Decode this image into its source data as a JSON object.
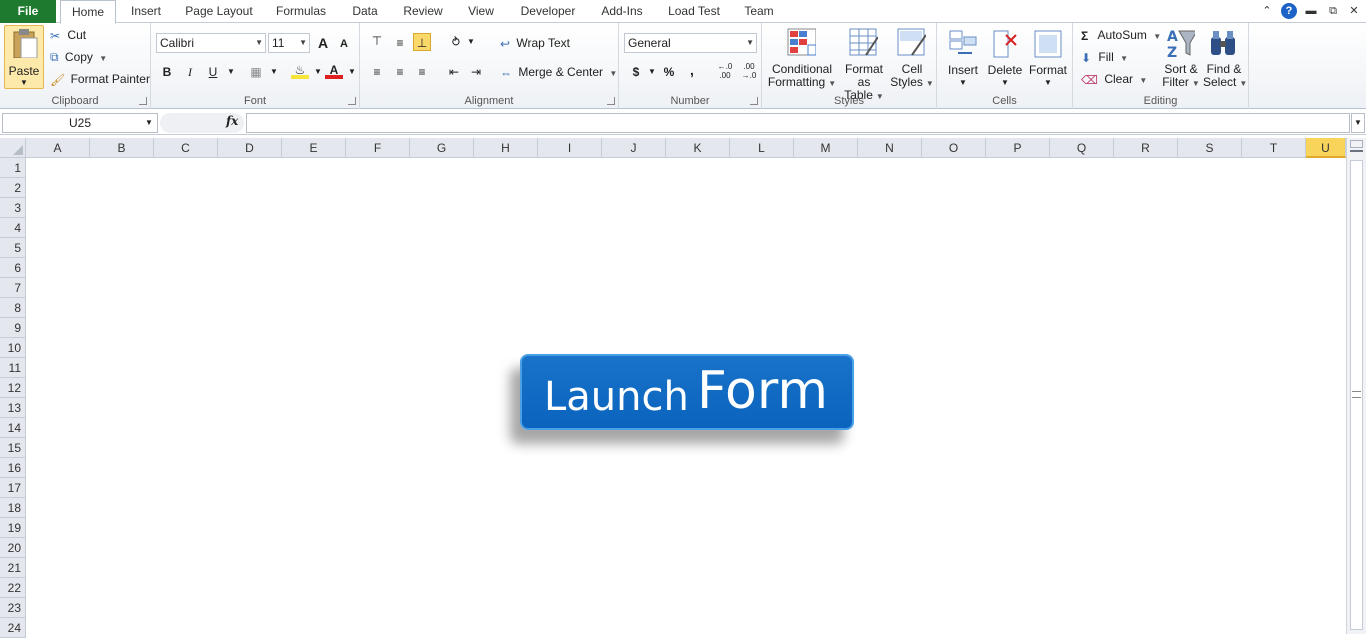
{
  "tabs": {
    "file": "File",
    "home": "Home",
    "insert": "Insert",
    "page_layout": "Page Layout",
    "formulas": "Formulas",
    "data": "Data",
    "review": "Review",
    "view": "View",
    "developer": "Developer",
    "add_ins": "Add-Ins",
    "load_test": "Load Test",
    "team": "Team"
  },
  "clipboard": {
    "paste": "Paste",
    "cut": "Cut",
    "copy": "Copy",
    "format_painter": "Format Painter",
    "label": "Clipboard"
  },
  "font": {
    "name": "Calibri",
    "size": "11",
    "bold": "B",
    "italic": "I",
    "underline": "U",
    "grow": "A",
    "shrink": "A",
    "label": "Font"
  },
  "alignment": {
    "wrap_text": "Wrap Text",
    "merge_center": "Merge & Center",
    "label": "Alignment"
  },
  "number": {
    "format": "General",
    "currency": "$",
    "percent": "%",
    "comma": ",",
    "inc_decimal": "←.0 .00",
    "dec_decimal": ".00 →.0",
    "label": "Number"
  },
  "styles": {
    "conditional_1": "Conditional",
    "conditional_2": "Formatting",
    "format_table_1": "Format",
    "format_table_2": "as Table",
    "cell_styles_1": "Cell",
    "cell_styles_2": "Styles",
    "label": "Styles"
  },
  "cells": {
    "insert": "Insert",
    "delete": "Delete",
    "format": "Format",
    "label": "Cells"
  },
  "editing": {
    "autosum": "AutoSum",
    "fill": "Fill",
    "clear": "Clear",
    "sort_1": "Sort &",
    "sort_2": "Filter",
    "find_1": "Find &",
    "find_2": "Select",
    "label": "Editing"
  },
  "formula_bar": {
    "name_box": "U25",
    "fx": "fx",
    "value": ""
  },
  "columns": [
    "A",
    "B",
    "C",
    "D",
    "E",
    "F",
    "G",
    "H",
    "I",
    "J",
    "K",
    "L",
    "M",
    "N",
    "O",
    "P",
    "Q",
    "R",
    "S",
    "T",
    "U"
  ],
  "selected_column": "U",
  "rows": [
    "1",
    "2",
    "3",
    "4",
    "5",
    "6",
    "7",
    "8",
    "9",
    "10",
    "11",
    "12",
    "13",
    "14",
    "15",
    "16",
    "17",
    "18",
    "19",
    "20",
    "21",
    "22",
    "23",
    "24"
  ],
  "launch_button": {
    "word1": "Launch",
    "word2": "Form"
  },
  "colors": {
    "file_tab": "#1e7a2f",
    "button_blue": "#0a63bd",
    "selected_header": "#f9d45a"
  }
}
